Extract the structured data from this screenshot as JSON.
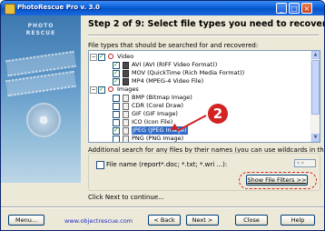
{
  "window": {
    "title": "PhotoRescue Pro v. 3.0",
    "controls": {
      "minimize": "_",
      "maximize": "□",
      "close": "×"
    }
  },
  "sidebar": {
    "logo_text": "PHOTO RESCUE"
  },
  "step_heading": "Step 2 of 9: Select file types you need to recover",
  "file_types_label": "File types that should be searched for and recovered:",
  "tree": [
    {
      "label": "Video",
      "level": 0,
      "expanded": true,
      "checked": true,
      "icon": "category-icon"
    },
    {
      "label": "AVI (AVI (RIFF Video Format))",
      "level": 1,
      "checked": true,
      "icon": "film-icon"
    },
    {
      "label": "MOV (QuickTime (Rich Media Format))",
      "level": 1,
      "checked": true,
      "icon": "film-icon"
    },
    {
      "label": "MP4 (MPEG-4 Video File)",
      "level": 1,
      "checked": true,
      "icon": "film-icon"
    },
    {
      "label": "Images",
      "level": 0,
      "expanded": true,
      "checked": true,
      "icon": "category-icon"
    },
    {
      "label": "BMP (Bitmap Image)",
      "level": 1,
      "checked": false,
      "icon": "file-icon"
    },
    {
      "label": "CDR (Corel Draw)",
      "level": 1,
      "checked": false,
      "icon": "file-icon"
    },
    {
      "label": "GIF (GIF Image)",
      "level": 1,
      "checked": false,
      "icon": "file-icon"
    },
    {
      "label": "ICO (Icon File)",
      "level": 1,
      "checked": false,
      "icon": "file-icon"
    },
    {
      "label": "JPEG (JPEG Image)",
      "level": 1,
      "checked": true,
      "selected": true,
      "icon": "file-icon"
    },
    {
      "label": "PNG (PNG Image)",
      "level": 1,
      "checked": false,
      "icon": "file-icon"
    }
  ],
  "annotation_badge": "2",
  "additional_search_label": "Additional search for any files by their names (you can use wildcards in them):",
  "file_name": {
    "label": "File name (report*.doc; *.txt; *.wri ...):",
    "placeholder": "*.*",
    "checked": false
  },
  "buttons": {
    "show_filters": "Show File Filters >>",
    "menu": "Menu...",
    "back": "< Back",
    "next": "Next >",
    "close": "Close",
    "help": "Help"
  },
  "footer_hint": "Click Next to continue...",
  "website": "www.objectrescue.com",
  "colors": {
    "accent": "#d42222",
    "selection": "#316ac5",
    "titlebar": "#0a5fd8"
  }
}
